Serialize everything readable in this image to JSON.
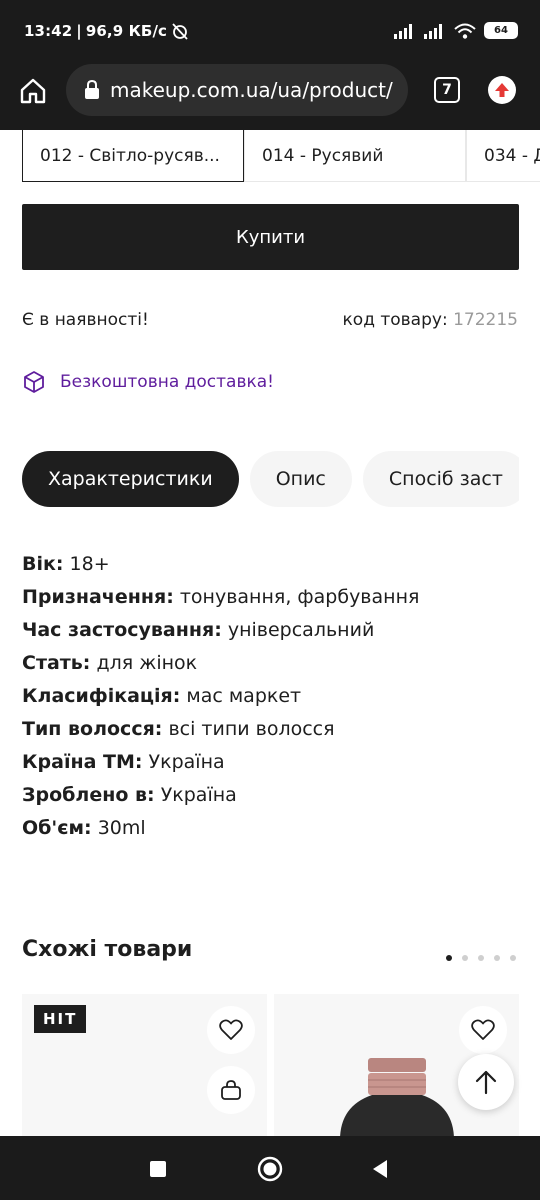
{
  "status_bar": {
    "time": "13:42",
    "speed": "96,9 КБ/с",
    "battery": "64"
  },
  "browser": {
    "url": "makeup.com.ua/ua/product/",
    "tab_count": "7"
  },
  "shades": [
    {
      "label": "012 - Світло-русяв..."
    },
    {
      "label": "014 - Русявий"
    },
    {
      "label": "034 - Д"
    }
  ],
  "buy_label": "Купити",
  "stock_label": "Є в наявності!",
  "code": {
    "label": "код товару:",
    "value": "172215"
  },
  "delivery_label": "Безкоштовна доставка!",
  "colors": {
    "accent": "#5f1d9d",
    "dark": "#1e1e1e"
  },
  "tabs": [
    {
      "label": "Характеристики"
    },
    {
      "label": "Опис"
    },
    {
      "label": "Спосіб заст"
    }
  ],
  "characteristics": [
    {
      "key": "Вік:",
      "value": "18+"
    },
    {
      "key": "Призначення:",
      "value": "тонування, фарбування"
    },
    {
      "key": "Час застосування:",
      "value": "універсальний"
    },
    {
      "key": "Стать:",
      "value": "для жінок"
    },
    {
      "key": "Класифікація:",
      "value": "мас маркет"
    },
    {
      "key": "Тип волосся:",
      "value": "всі типи волосся"
    },
    {
      "key": "Країна ТМ:",
      "value": "Україна"
    },
    {
      "key": "Зроблено в:",
      "value": "Україна"
    },
    {
      "key": "Об'єм:",
      "value": "30ml"
    }
  ],
  "similar": {
    "title": "Схожі товари",
    "badge": "HIT"
  }
}
